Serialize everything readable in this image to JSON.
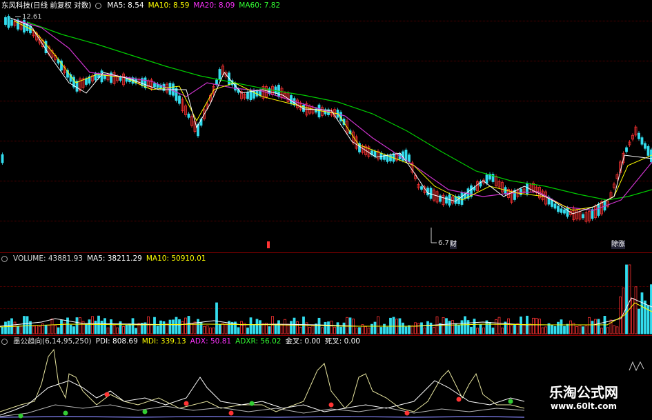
{
  "price_panel": {
    "title": "东风科技(日线 前复权 对数)",
    "ma5": "MA5: 8.54",
    "ma10": "MA10: 8.59",
    "ma20": "MA20: 8.09",
    "ma60": "MA60: 7.82",
    "high_label": "12.61",
    "low_label": "6.7",
    "marker_cai": "财",
    "marker_zhangtie": "除涨",
    "colors": {
      "ma5": "#ffffff",
      "ma10": "#ffff00",
      "ma20": "#ff00ff",
      "ma60": "#00ff00",
      "up": "#ff3333",
      "down": "#00ffff"
    }
  },
  "volume_panel": {
    "title": "VOLUME: 43881.93",
    "ma5": "MA5: 38211.29",
    "ma10": "MA10: 50910.01"
  },
  "indicator_panel": {
    "title": "墨公趋向(6,14,95,250)",
    "pdi": "PDI: 808.69",
    "mdi": "MDI: 339.13",
    "adx": "ADX: 50.81",
    "adxr": "ADXR: 56.02",
    "jincha": "金叉: 0.00",
    "sicha": "死叉: 0.00"
  },
  "watermark": {
    "name": "乐淘公式网",
    "url": "www.60lt.com"
  }
}
